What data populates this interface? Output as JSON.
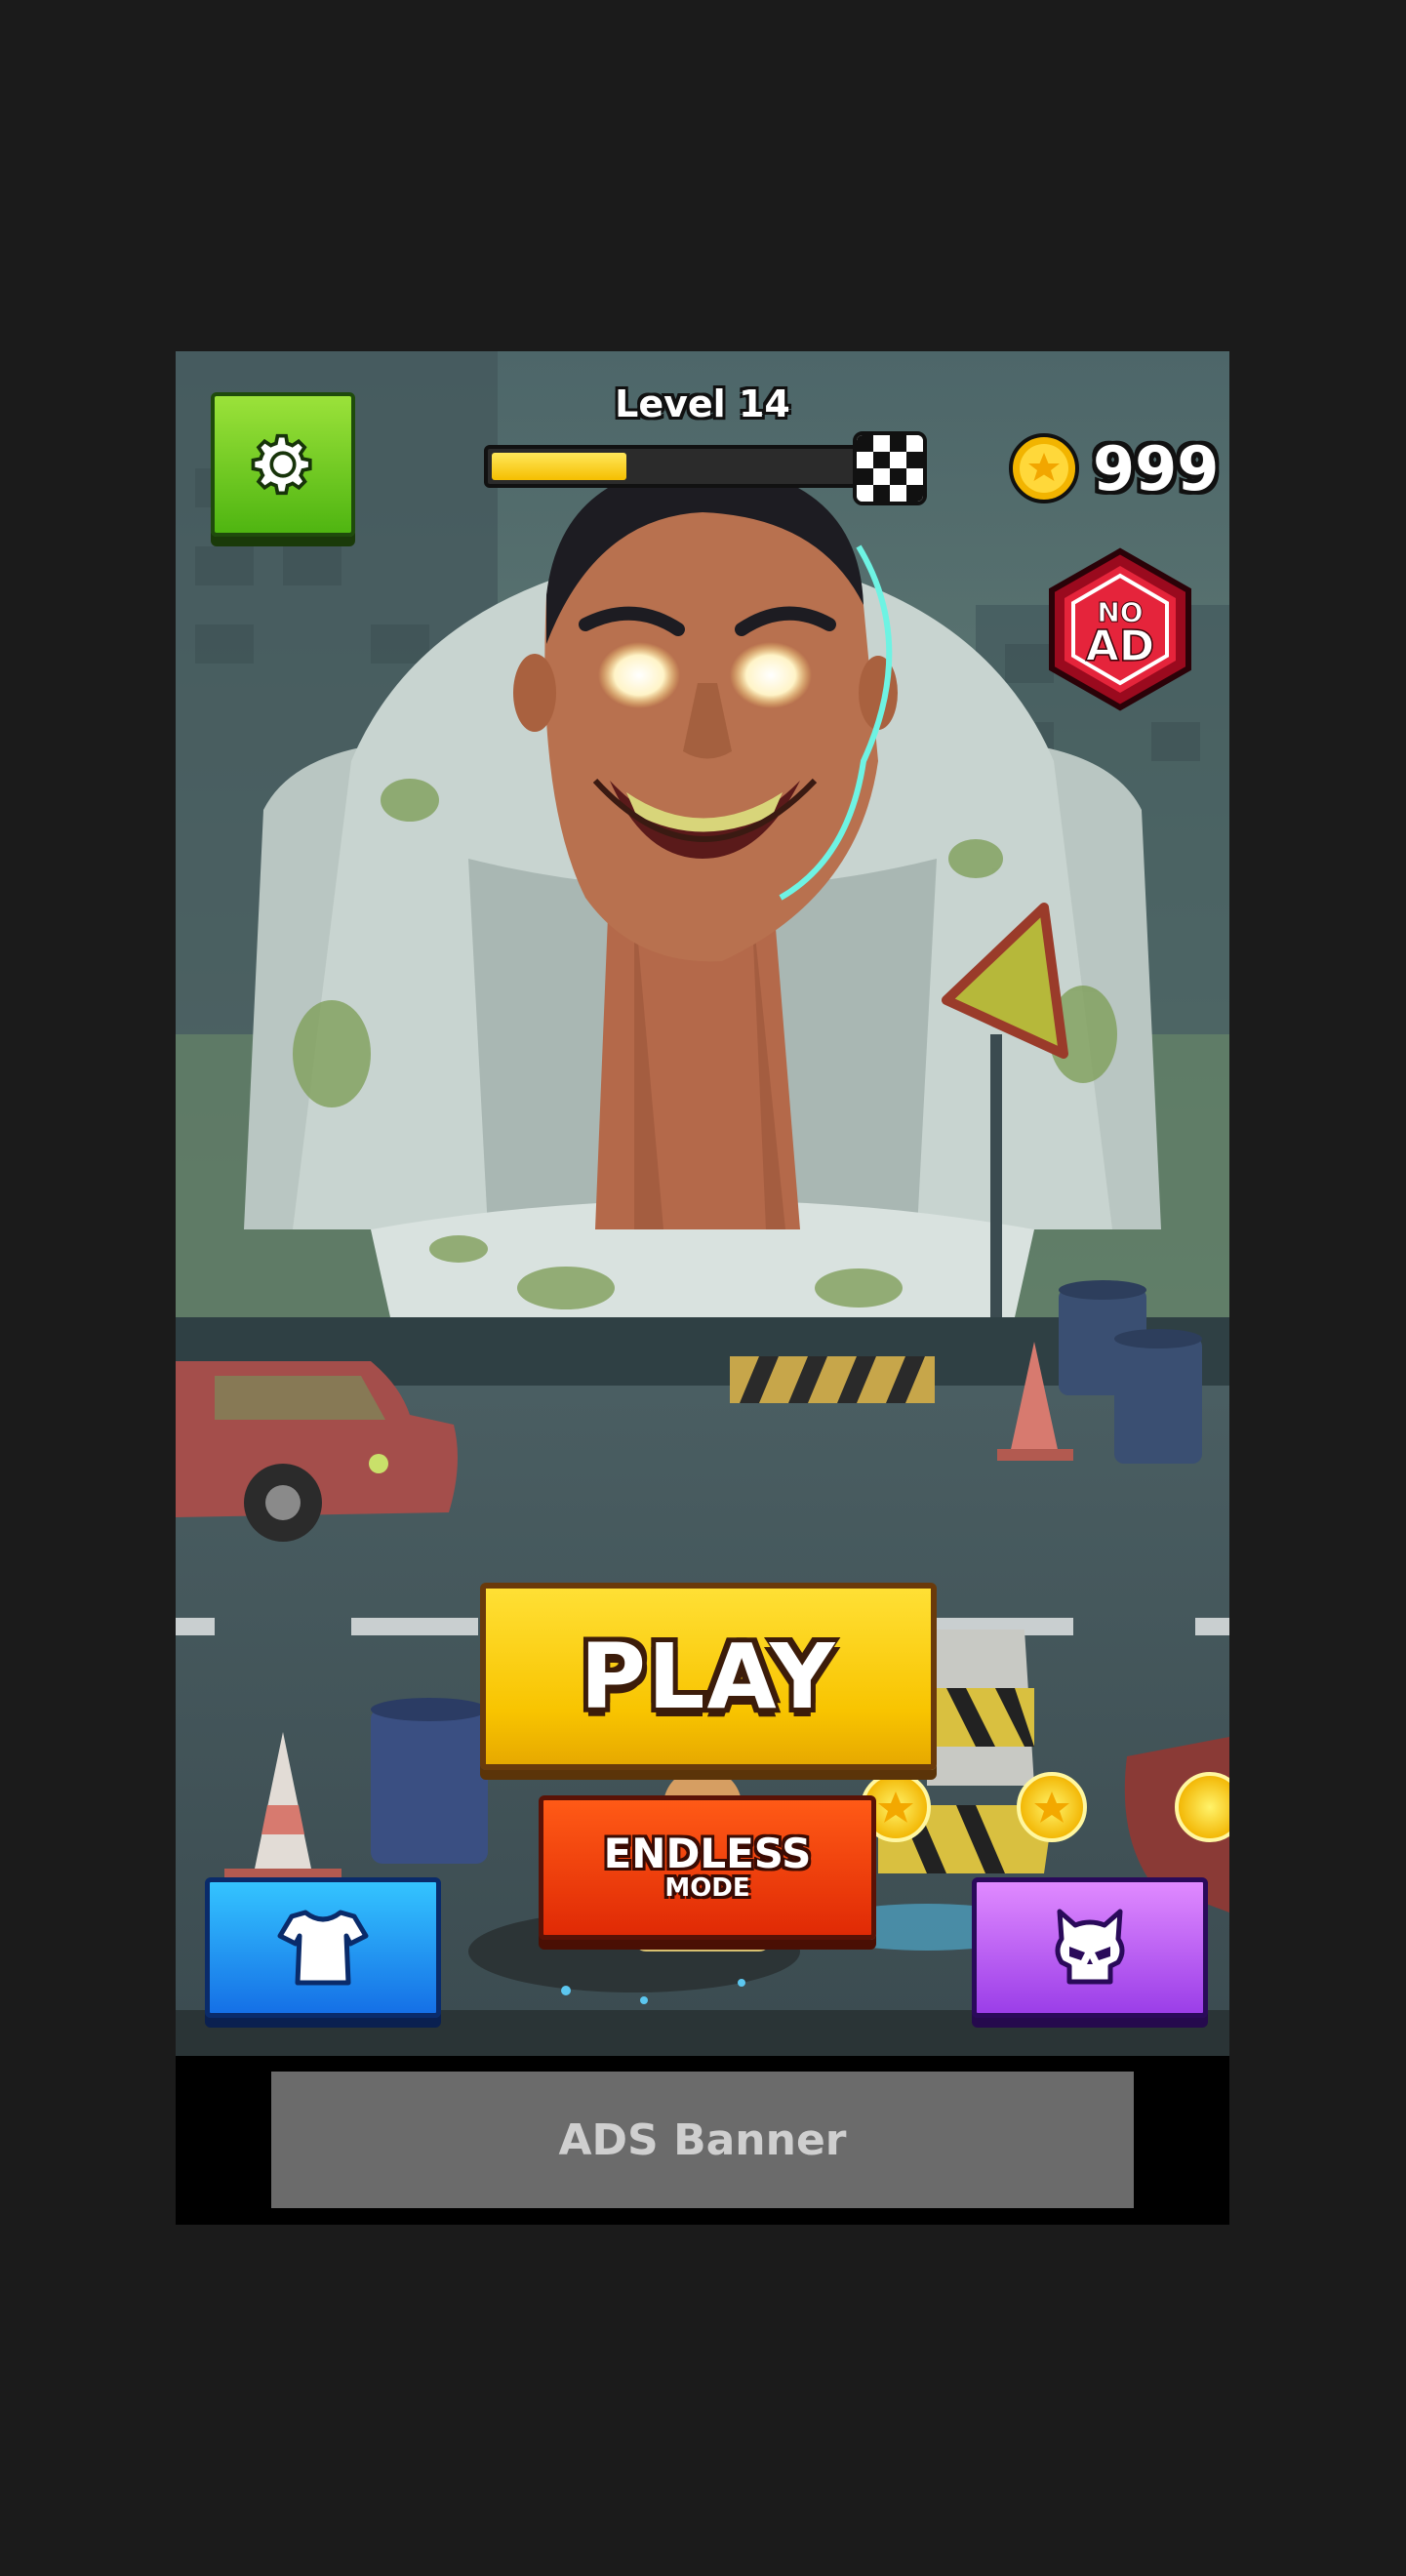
{
  "hud": {
    "level_label": "Level 14",
    "level_progress_percent": 37,
    "coins": "999"
  },
  "badge": {
    "no_label": "NO",
    "ad_label": "AD"
  },
  "buttons": {
    "play": "PLAY",
    "endless": "ENDLESS",
    "endless_sub": "MODE"
  },
  "ad_banner": {
    "label": "ADS Banner"
  },
  "icons": {
    "settings": "gear-icon",
    "finish": "checkered-flag-icon",
    "coin": "coin-star-icon",
    "no_ads": "no-ads-badge-icon",
    "skins": "t-shirt-icon",
    "enemies": "skull-icon"
  },
  "colors": {
    "settings": "#5fc31a",
    "play": "#f8c400",
    "endless": "#e93a0a",
    "skins": "#1f8df0",
    "enemies": "#b65af2",
    "progress": "#f5c000"
  }
}
